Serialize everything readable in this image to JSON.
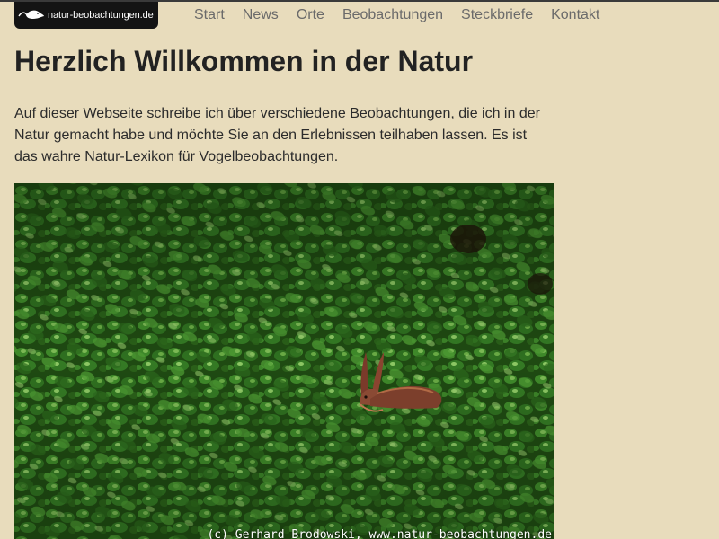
{
  "header": {
    "logo_text": "natur-beobachtungen.de",
    "logo_icon": "bird-icon"
  },
  "nav": {
    "items": [
      {
        "label": "Start"
      },
      {
        "label": "News"
      },
      {
        "label": "Orte"
      },
      {
        "label": "Beobachtungen"
      },
      {
        "label": "Steckbriefe"
      },
      {
        "label": "Kontakt"
      }
    ]
  },
  "main": {
    "title": "Herzlich Willkommen in der Natur",
    "intro": "Auf dieser Webseite schreibe ich über verschiedene Beobachtungen, die ich in der Natur gemacht habe und möchte Sie an den Erlebnissen teilhaben lassen. Es ist das wahre Natur-Lexikon für Vogelbeobachtungen.",
    "image": {
      "credit": "(c) Gerhard Brodowski, www.natur-beobachtungen.de"
    }
  },
  "colors": {
    "background": "#e8dcbc",
    "logo_bg": "#141414",
    "nav_text": "#6a6a6a",
    "title_text": "#222222",
    "foliage": "#2f6a1f"
  }
}
